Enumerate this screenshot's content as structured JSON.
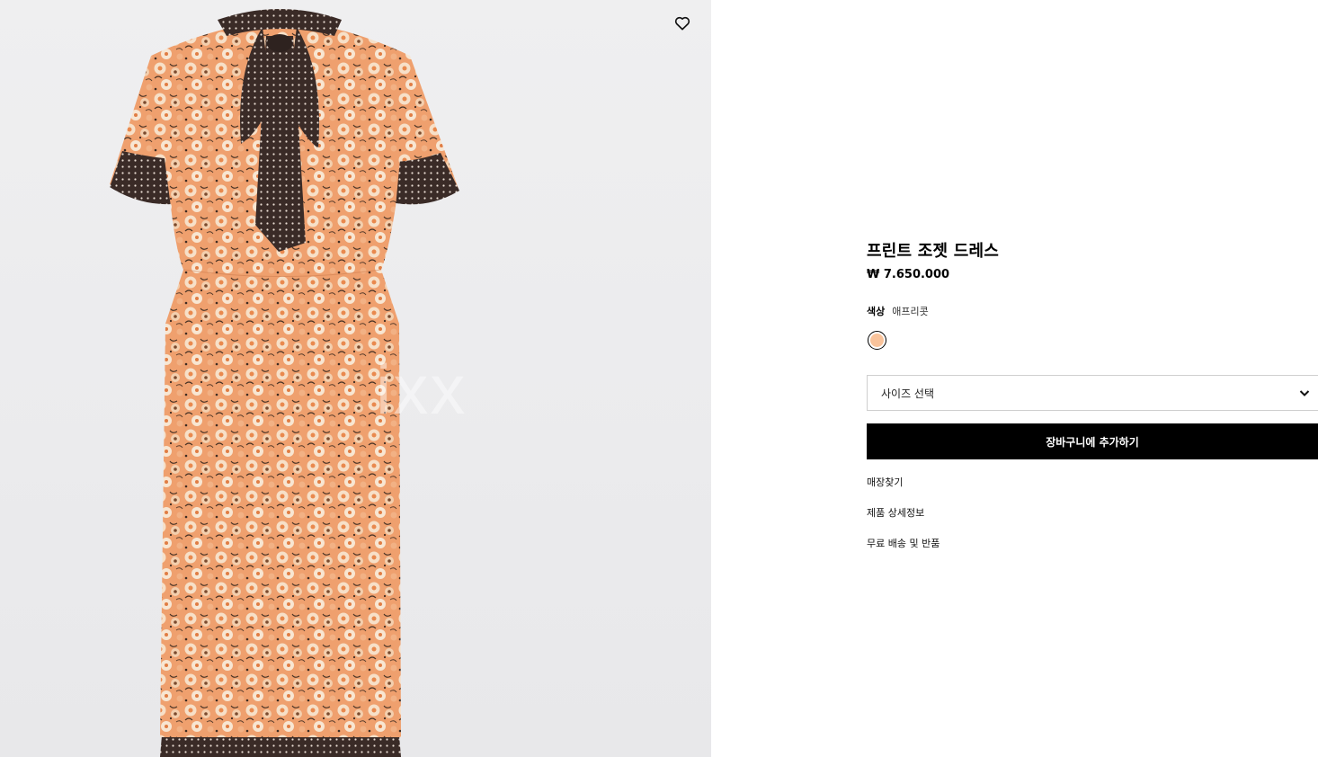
{
  "product": {
    "title": "프린트 조젯 드레스",
    "price": "₩ 7.650.000",
    "watermark": "ixx"
  },
  "color": {
    "label": "색상",
    "value": "애프리콧",
    "swatch_hex": "#f9c39b"
  },
  "size_select": {
    "placeholder": "사이즈 선택",
    "icon": "chevron-down-icon"
  },
  "actions": {
    "add_to_cart": "장바구니에 추가하기",
    "wishlist_icon": "heart-icon"
  },
  "links": [
    {
      "label": "매장찾기"
    },
    {
      "label": "제품 상세정보"
    },
    {
      "label": "무료 배송 및 반품"
    }
  ],
  "colors": {
    "image_background": "#ececee",
    "dress_base": "#f0a577",
    "dress_dark": "#3a2a26",
    "button_bg": "#000000"
  }
}
